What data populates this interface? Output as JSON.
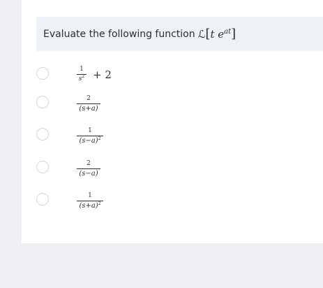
{
  "question": {
    "prefix": "Evaluate the following function",
    "operator": "ℒ",
    "open_bracket": "[",
    "var_t": "t",
    "base": "e",
    "exponent": "at",
    "close_bracket": "]"
  },
  "options": [
    {
      "num": "1",
      "den_main": "s",
      "den_sup": "2",
      "suffix": "+ 2"
    },
    {
      "num": "2",
      "den": "(s+a)"
    },
    {
      "num": "1",
      "den": "(s−a)",
      "den_sup": "2"
    },
    {
      "num": "2",
      "den": "(s−a)"
    },
    {
      "num": "1",
      "den": "(s+a)",
      "den_sup": "2"
    }
  ],
  "colors": {
    "page_background": "#eef0f3",
    "card_background": "#ffffff",
    "question_bar_background": "#eef1f5",
    "text": "#2a2f36",
    "radio_border": "#d3d6db"
  }
}
